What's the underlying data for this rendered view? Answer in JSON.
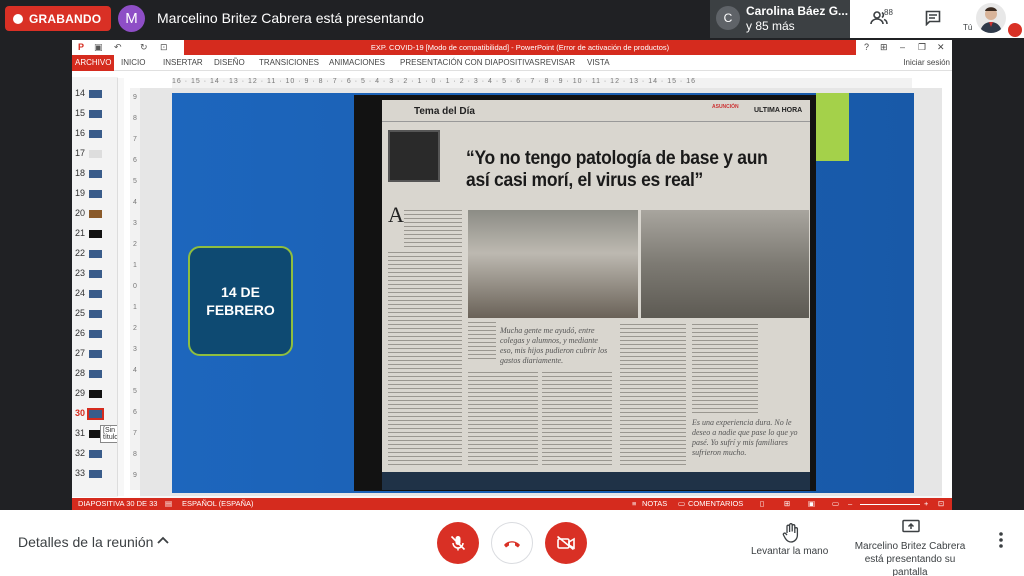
{
  "meet": {
    "recording_label": "GRABANDO",
    "presenter_initial": "M",
    "presenter_title": "Marcelino Britez Cabrera está presentando",
    "participant_initial": "C",
    "participant_name": "Carolina Báez G...",
    "participant_more": "y 85 más",
    "people_count": "88",
    "self_label": "Tú",
    "meeting_details": "Detalles de la reunión",
    "raise_hand": "Levantar la mano",
    "presenting_line1": "Marcelino Britez Cabrera",
    "presenting_line2": "está presentando su pantalla",
    "colors": {
      "red": "#d93025",
      "avatar_purple": "#8e4ec6",
      "bar": "#202124"
    }
  },
  "ppt": {
    "title": "EXP. COVID-19 [Modo de compatibilidad] - PowerPoint (Error de activación de productos)",
    "tabs": [
      "ARCHIVO",
      "INICIO",
      "INSERTAR",
      "DISEÑO",
      "TRANSICIONES",
      "ANIMACIONES",
      "PRESENTACIÓN CON DIAPOSITIVAS",
      "REVISAR",
      "VISTA"
    ],
    "signin": "Iniciar sesión",
    "slide_numbers": [
      "14",
      "15",
      "16",
      "17",
      "18",
      "19",
      "20",
      "21",
      "22",
      "23",
      "24",
      "25",
      "26",
      "27",
      "28",
      "29",
      "30",
      "31",
      "32",
      "33"
    ],
    "selected_slide": "30",
    "tooltip": "[Sin título]",
    "ruler_h": "16 · 15 · 14 · 13 · 12 · 11 · 10 · 9 · 8 · 7 · 6 · 5 · 4 · 3 · 2 · 1 · 0 · 1 · 2 · 3 · 4 · 5 · 6 · 7 · 8 · 9 · 10 · 11 · 12 · 13 · 14 · 15 · 16",
    "ruler_v": [
      "9",
      "8",
      "7",
      "6",
      "5",
      "4",
      "3",
      "2",
      "1",
      "0",
      "1",
      "2",
      "3",
      "4",
      "5",
      "6",
      "7",
      "8",
      "9"
    ],
    "status_slide": "DIAPOSITIVA 30 DE 33",
    "status_lang": "ESPAÑOL (ESPAÑA)",
    "status_notes": "NOTAS",
    "status_comments": "COMENTARIOS",
    "accent": "#d52b1e"
  },
  "slide": {
    "date_line1": "14 DE",
    "date_line2": "FEBRERO",
    "paper_section": "Tema del Día",
    "paper_city": "ASUNCIÓN",
    "paper_ultima": "ULTIMA HORA",
    "headline": "“Yo no tengo patología de base y aun así casi morí, el virus es real”",
    "quote1": "Mucha gente me ayudó, entre colegas y alumnos, y mediante eso, mis hijos pudieron cubrir los gastos diariamente.",
    "quote2": "Es una experiencia dura. No le deseo a nadie que pase lo que yo pasé. Yo sufrí y mis familiares sufrieron mucho.",
    "colors": {
      "slide_blue": "#1a5fb0",
      "date_box": "#0e4a72",
      "green": "#a4d14a"
    }
  }
}
